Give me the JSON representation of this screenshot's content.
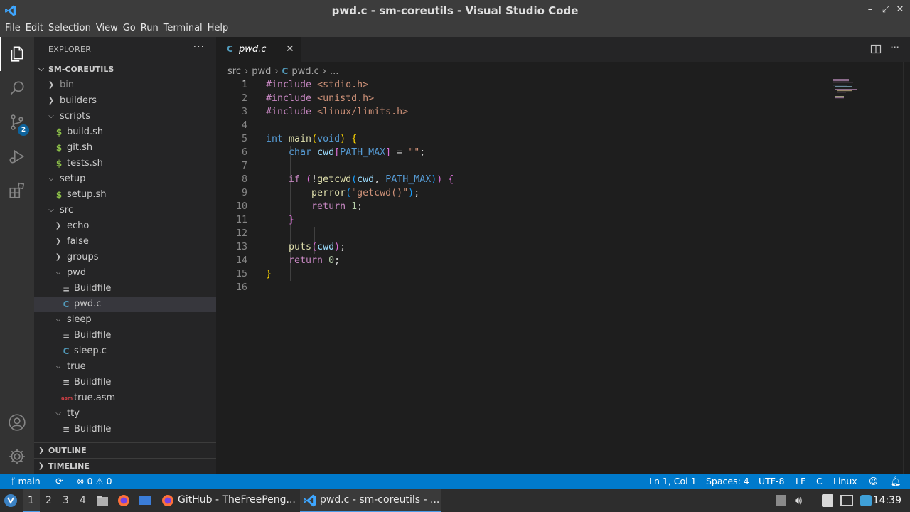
{
  "window": {
    "title": "pwd.c - sm-coreutils - Visual Studio Code",
    "minimize": "–",
    "maximize": "⤢",
    "close": "✕"
  },
  "menu": [
    "File",
    "Edit",
    "Selection",
    "View",
    "Go",
    "Run",
    "Terminal",
    "Help"
  ],
  "activity": {
    "scm_badge": "2"
  },
  "sidebar": {
    "header": "EXPLORER",
    "more": "···",
    "root": "SM-COREUTILS",
    "tree": [
      {
        "label": "bin",
        "type": "folder",
        "depth": 1,
        "open": false,
        "dim": true
      },
      {
        "label": "builders",
        "type": "folder",
        "depth": 1,
        "open": false
      },
      {
        "label": "scripts",
        "type": "folder",
        "depth": 1,
        "open": true
      },
      {
        "label": "build.sh",
        "type": "sh",
        "depth": 2
      },
      {
        "label": "git.sh",
        "type": "sh",
        "depth": 2
      },
      {
        "label": "tests.sh",
        "type": "sh",
        "depth": 2
      },
      {
        "label": "setup",
        "type": "folder",
        "depth": 1,
        "open": true
      },
      {
        "label": "setup.sh",
        "type": "sh",
        "depth": 2
      },
      {
        "label": "src",
        "type": "folder",
        "depth": 1,
        "open": true
      },
      {
        "label": "echo",
        "type": "folder",
        "depth": 2,
        "open": false
      },
      {
        "label": "false",
        "type": "folder",
        "depth": 2,
        "open": false
      },
      {
        "label": "groups",
        "type": "folder",
        "depth": 2,
        "open": false
      },
      {
        "label": "pwd",
        "type": "folder",
        "depth": 2,
        "open": true
      },
      {
        "label": "Buildfile",
        "type": "build",
        "depth": 3
      },
      {
        "label": "pwd.c",
        "type": "c",
        "depth": 3,
        "selected": true
      },
      {
        "label": "sleep",
        "type": "folder",
        "depth": 2,
        "open": true
      },
      {
        "label": "Buildfile",
        "type": "build",
        "depth": 3
      },
      {
        "label": "sleep.c",
        "type": "c",
        "depth": 3
      },
      {
        "label": "true",
        "type": "folder",
        "depth": 2,
        "open": true
      },
      {
        "label": "Buildfile",
        "type": "build",
        "depth": 3
      },
      {
        "label": "true.asm",
        "type": "asm",
        "depth": 3
      },
      {
        "label": "tty",
        "type": "folder",
        "depth": 2,
        "open": true
      },
      {
        "label": "Buildfile",
        "type": "build",
        "depth": 3
      }
    ],
    "outline": "OUTLINE",
    "timeline": "TIMELINE"
  },
  "editor": {
    "tab": {
      "icon": "C",
      "label": "pwd.c",
      "close": "✕"
    },
    "breadcrumbs": {
      "p1": "src",
      "p2": "pwd",
      "icon": "C",
      "p3": "pwd.c",
      "p4": "..."
    },
    "lines": [
      [
        [
          "t-pre",
          "#include "
        ],
        [
          "t-str",
          "<stdio.h>"
        ]
      ],
      [
        [
          "t-pre",
          "#include "
        ],
        [
          "t-str",
          "<unistd.h>"
        ]
      ],
      [
        [
          "t-pre",
          "#include "
        ],
        [
          "t-str",
          "<linux/limits.h>"
        ]
      ],
      [],
      [
        [
          "t-kw",
          "int "
        ],
        [
          "t-fn",
          "main"
        ],
        [
          "t-br1",
          "("
        ],
        [
          "t-kw",
          "void"
        ],
        [
          "t-br1",
          ")"
        ],
        [
          "",
          ""
        ],
        [
          "",
          " "
        ],
        [
          "t-br1",
          "{"
        ]
      ],
      [
        [
          "",
          "    "
        ],
        [
          "t-kw",
          "char "
        ],
        [
          "t-var",
          "cwd"
        ],
        [
          "t-br2",
          "["
        ],
        [
          "t-mac",
          "PATH_MAX"
        ],
        [
          "t-br2",
          "]"
        ],
        [
          "",
          " = "
        ],
        [
          "t-str",
          "\"\""
        ],
        [
          "",
          ";"
        ]
      ],
      [],
      [
        [
          "",
          "    "
        ],
        [
          "t-ctrl",
          "if "
        ],
        [
          "t-br2",
          "("
        ],
        [
          "",
          "!"
        ],
        [
          "t-fn",
          "getcwd"
        ],
        [
          "t-br3",
          "("
        ],
        [
          "t-var",
          "cwd"
        ],
        [
          "",
          ", "
        ],
        [
          "t-mac",
          "PATH_MAX"
        ],
        [
          "t-br3",
          ")"
        ],
        [
          "t-br2",
          ")"
        ],
        [
          "",
          " "
        ],
        [
          "t-br2",
          "{"
        ]
      ],
      [
        [
          "",
          "        "
        ],
        [
          "t-fn",
          "perror"
        ],
        [
          "t-br3",
          "("
        ],
        [
          "t-str",
          "\"getcwd()\""
        ],
        [
          "t-br3",
          ")"
        ],
        [
          "",
          ";"
        ]
      ],
      [
        [
          "",
          "        "
        ],
        [
          "t-ctrl",
          "return "
        ],
        [
          "t-num",
          "1"
        ],
        [
          "",
          ";"
        ]
      ],
      [
        [
          "",
          "    "
        ],
        [
          "t-br2",
          "}"
        ]
      ],
      [],
      [
        [
          "",
          "    "
        ],
        [
          "t-fn",
          "puts"
        ],
        [
          "t-br2",
          "("
        ],
        [
          "t-var",
          "cwd"
        ],
        [
          "t-br2",
          ")"
        ],
        [
          "",
          ";"
        ]
      ],
      [
        [
          "",
          "    "
        ],
        [
          "t-ctrl",
          "return "
        ],
        [
          "t-num",
          "0"
        ],
        [
          "",
          ";"
        ]
      ],
      [
        [
          "t-br1",
          "}"
        ]
      ],
      []
    ]
  },
  "status": {
    "branch": "main",
    "errors": "0",
    "warnings": "0",
    "position": "Ln 1, Col 1",
    "spaces": "Spaces: 4",
    "encoding": "UTF-8",
    "eol": "LF",
    "language": "C",
    "os": "Linux"
  },
  "taskbar": {
    "workspaces": [
      "1",
      "2",
      "3",
      "4"
    ],
    "win1": "GitHub - TheFreePeng...",
    "win2": "pwd.c - sm-coreutils - ...",
    "clock": "14:39"
  },
  "colors": {
    "accent": "#007acc",
    "activity_bg": "#333333",
    "sidebar_bg": "#252526",
    "editor_bg": "#1e1e1e"
  }
}
